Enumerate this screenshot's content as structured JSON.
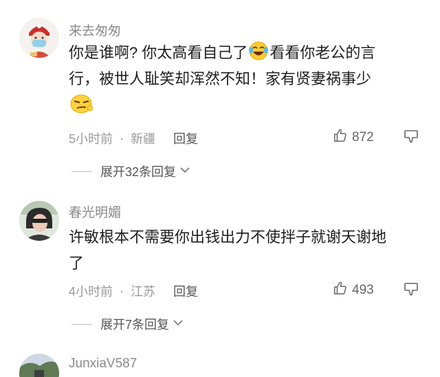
{
  "comments": [
    {
      "username": "来去匆匆",
      "text_line1_a": "你是谁啊? 你太高看自己了",
      "text_line1_b": "看看你老公的言",
      "text_line2": "行，被世人耻笑却浑然不知！家有贤妻祸事少",
      "time": "5小时前",
      "location": "新疆",
      "reply_label": "回复",
      "likes": "872",
      "expand_label": "展开32条回复",
      "emoji1": "laughing-tears-emoji",
      "emoji2": "smirk-emoji"
    },
    {
      "username": "春光明媚",
      "text_line1": "许敏根本不需要你出钱出力不使拌子就谢天谢地",
      "text_line2": "了",
      "time": "4小时前",
      "location": "江苏",
      "reply_label": "回复",
      "likes": "493",
      "expand_label": "展开7条回复"
    },
    {
      "username": "JunxiaV587"
    }
  ],
  "separator": "·"
}
